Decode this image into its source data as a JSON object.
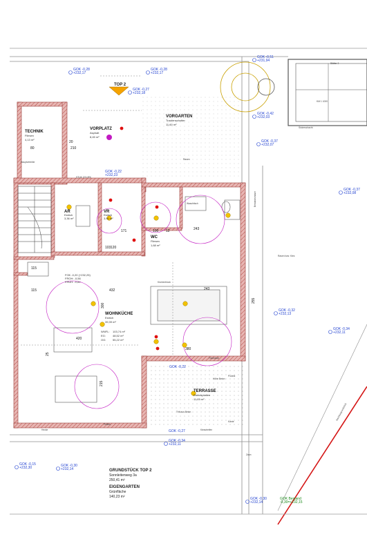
{
  "colors": {
    "wall_fill": "#e7b6b3",
    "wall_stroke": "#9a3b37",
    "hatch": "#b24a44",
    "level_blue": "#1f3fd0",
    "electric_magenta": "#c21ac2",
    "light_yellow": "#f2c200",
    "red_dot": "#e01010",
    "property_line": "#d41414",
    "green": "#1a8a1a"
  },
  "header": {
    "top_label": "TOP 2",
    "north_label": "Blätter 2"
  },
  "levels": {
    "gok_top_left": "GOK -0,28",
    "gok_top_left_abs": "+232,17",
    "gok_top_center": "GOK -0,28",
    "gok_top_center_abs": "+232,17",
    "gok_top_right": "GOK -0,51",
    "gok_top_right_abs": "+231,94",
    "gok_027": "GOK -0,27",
    "gok_027_abs": "+232,18",
    "gok_042": "GOK -0,42",
    "gok_042_abs": "+232,03",
    "gok_037": "GOK -0,37",
    "gok_037_abs": "+232,07",
    "gok_037b": "GOK -0,37",
    "gok_037b_abs": "+232,08",
    "gok_032": "GOK -0,32",
    "gok_032_abs": "+232,13",
    "gok_034b": "GOK -0,34",
    "gok_034b_abs": "+232,11",
    "gok_022": "GOK -0,22",
    "gok_022_abs": "+232,23",
    "gok_022b": "GOK -0,22",
    "gok_027b": "GOK -0,27",
    "gok_034": "GOK -0,34",
    "gok_034_abs": "+232,11",
    "gok_015": "GOK -0,15",
    "gok_015_abs": "+232,30",
    "gok_030": "GOK -0,30",
    "gok_030_abs": "+232,14",
    "gok_030b": "GOK -0,30",
    "gok_030b_abs": "+232,14",
    "gok_bestand": "GOK Bestand",
    "gok_bestand_abs": "-0,30=+232,15"
  },
  "rooms": {
    "technik": {
      "name": "TECHNIK",
      "floor": "Fliesen",
      "area": "4,13 m²"
    },
    "vorplatz": {
      "name": "VORPLATZ",
      "floor": "Asphalt",
      "area": "8,45 m²"
    },
    "vorgarten": {
      "name": "VORGARTEN",
      "floor": "Traufenschotter",
      "area": "11,60 m²"
    },
    "ar": {
      "name": "AR",
      "floor": "Estrich",
      "area": "3,36 m²"
    },
    "vr": {
      "name": "VR",
      "floor": "Estrich",
      "area": "3,90 m²"
    },
    "wc": {
      "name": "WC",
      "floor": "Fliesen",
      "area": "1,68 m²"
    },
    "wohnkueche": {
      "name": "WOHNKÜCHE",
      "floor": "Estrich",
      "area": "39,39 m²"
    },
    "terrasse": {
      "name": "TERRASSE",
      "floor": "Estrichplatten",
      "area": "11,05 m²"
    },
    "wnfl": {
      "label": "WNFL:",
      "value": "103,74 m²",
      "eg": "EG:",
      "eg_value": "48,52 m²",
      "og": "OG:",
      "og_value": "55,22 m²"
    }
  },
  "fok": {
    "line1": "FOK -0,20 (+232,25)",
    "line2": "FROH: -0,56",
    "line3": "FRUH: -0,81"
  },
  "plot": {
    "title": "GRUNDSTÜCK TOP 2",
    "address": "Sonnleitenweg 3a",
    "area": "250,41 m²",
    "garden_title": "EIGENGARTEN",
    "garden_floor": "Grünfläche",
    "garden_area": "140,23 m²"
  },
  "dims": {
    "d243a": "243",
    "d243b": "243",
    "d420": "420",
    "d380": "380",
    "d300": "300",
    "d432": "432",
    "d115a": "115",
    "d115b": "115",
    "d171": "171",
    "d103": "103",
    "d100": "100",
    "d12": "12",
    "d20": "20",
    "d215": "215",
    "d255": "255",
    "d210": "210",
    "d120": "120",
    "d25": "25",
    "d80": "80"
  },
  "notes": {
    "waschtisch": "Waschtisch",
    "kuechenblock": "Küchenblock",
    "hauptverteiler": "Hauptverteiler",
    "pellets": "Pellets",
    "rasen": "Rasen",
    "rasen_b": "Rasen bzw. Kies",
    "sickerschacht": "Sickerschacht",
    "hoehe_beton": "Höhe Beton",
    "bestandsmauer": "Bestandsmauer",
    "zaun": "Zaun",
    "nachbar": "Nachbargrundstück",
    "tritt_beton": "Tritt aus Beton",
    "hecke": "Hecke",
    "flachdach": "Flachdach",
    "podest": "Podest",
    "kiesstreifen": "Kiesstreifen",
    "kante": "Kante",
    "stuk": "STUK 2/3 HFK",
    "km": "KM 1 1000"
  }
}
